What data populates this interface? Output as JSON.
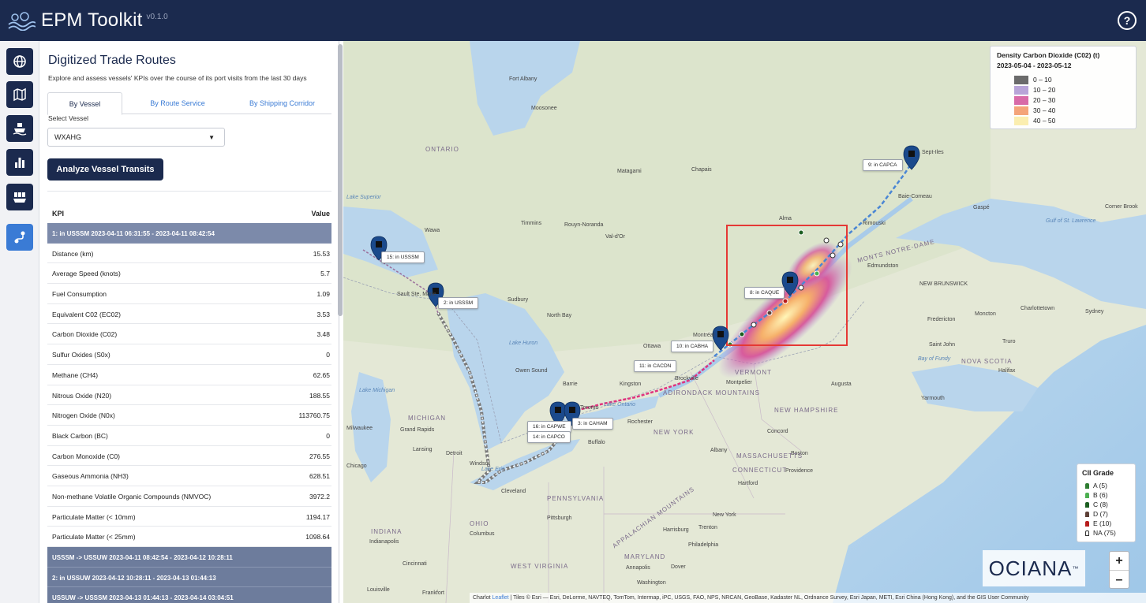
{
  "header": {
    "title": "EPM Toolkit",
    "version": "v0.1.0"
  },
  "rail": {
    "items": [
      {
        "icon": "globe-icon"
      },
      {
        "icon": "map-icon"
      },
      {
        "icon": "ship-icon"
      },
      {
        "icon": "bar-chart-icon"
      },
      {
        "icon": "port-icon"
      },
      {
        "icon": "route-icon",
        "active": true
      }
    ]
  },
  "panel": {
    "title": "Digitized Trade Routes",
    "subtitle": "Explore and assess vessels' KPIs over the course of its port visits from the last 30 days",
    "tabs": [
      "By Vessel",
      "By Route Service",
      "By Shipping Corridor"
    ],
    "vessel_label": "Select Vessel",
    "vessel_value": "WXAHG",
    "analyze_button": "Analyze Vessel Transits",
    "kpi_header": "KPI",
    "value_header": "Value",
    "active_segment": "1: in USSSM 2023-04-11 06:31:55 - 2023-04-11 08:42:54",
    "kpis": [
      {
        "name": "Distance (km)",
        "value": "15.53"
      },
      {
        "name": "Average Speed (knots)",
        "value": "5.7"
      },
      {
        "name": "Fuel Consumption",
        "value": "1.09"
      },
      {
        "name": "Equivalent C02 (EC02)",
        "value": "3.53"
      },
      {
        "name": "Carbon Dioxide (C02)",
        "value": "3.48"
      },
      {
        "name": "Sulfur Oxides (S0x)",
        "value": "0"
      },
      {
        "name": "Methane (CH4)",
        "value": "62.65"
      },
      {
        "name": "Nitrous Oxide (N20)",
        "value": "188.55"
      },
      {
        "name": "Nitrogen Oxide (N0x)",
        "value": "113760.75"
      },
      {
        "name": "Black Carbon (BC)",
        "value": "0"
      },
      {
        "name": "Carbon Monoxide (C0)",
        "value": "276.55"
      },
      {
        "name": "Gaseous Ammonia (NH3)",
        "value": "628.51"
      },
      {
        "name": "Non-methane Volatile Organic Compounds (NMVOC)",
        "value": "3972.2"
      },
      {
        "name": "Particulate Matter (< 10mm)",
        "value": "1194.17"
      },
      {
        "name": "Particulate Matter (< 25mm)",
        "value": "1098.64"
      }
    ],
    "segments": [
      "USSSM -> USSUW 2023-04-11 08:42:54 - 2023-04-12 10:28:11",
      "2: in USSUW 2023-04-12 10:28:11 - 2023-04-13 01:44:13",
      "USSUW -> USSSM 2023-04-13 01:44:13 - 2023-04-14 03:04:51"
    ]
  },
  "map": {
    "legend": {
      "title": "Density Carbon Dioxide (C02) (t)",
      "dates": "2023-05-04 - 2023-05-12",
      "bins": [
        {
          "label": "0 – 10",
          "color": "#6b6b6b"
        },
        {
          "label": "10 – 20",
          "color": "#b8a4d8"
        },
        {
          "label": "20 – 30",
          "color": "#d86aa8"
        },
        {
          "label": "30 – 40",
          "color": "#f4a47a"
        },
        {
          "label": "40 – 50",
          "color": "#fbeeb0"
        }
      ]
    },
    "cii": {
      "title": "CII Grade",
      "grades": [
        {
          "label": "A (5)",
          "color": "#2e7d32"
        },
        {
          "label": "B (6)",
          "color": "#4caf50"
        },
        {
          "label": "C (8)",
          "color": "#1b5e20"
        },
        {
          "label": "D (7)",
          "color": "#5d4037"
        },
        {
          "label": "E (10)",
          "color": "#b71c1c"
        },
        {
          "label": "NA (75)",
          "color": "#ffffff"
        }
      ]
    },
    "brand": "OCIANA",
    "zoom_in": "+",
    "zoom_out": "–",
    "attribution_prefix": "Charlot",
    "attribution_link": "Leaflet",
    "attribution_text": "| Tiles © Esri — Esri, DeLorme, NAVTEQ, TomTom, Intermap, iPC, USGS, FAO, NPS, NRCAN, GeoBase, Kadaster NL, Ordnance Survey, Esri Japan, METI, Esri China (Hong Kong), and the GIS User Community",
    "ports": [
      {
        "label": "9: in CAPCA"
      },
      {
        "label": "15: in USSSM"
      },
      {
        "label": "2: in USSSM"
      },
      {
        "label": "8: in CAQUE"
      },
      {
        "label": "10: in CABHA"
      },
      {
        "label": "11: in CACDN"
      },
      {
        "label": "16: in CAPWE"
      },
      {
        "label": "14: in CAPCO"
      },
      {
        "label": "3: in CAHAM"
      }
    ],
    "places": [
      "Fort Albany",
      "Moosonee",
      "ONTARIO",
      "Matagami",
      "Chapais",
      "Sept-Iles",
      "Baie-Comeau",
      "Gaspé",
      "Timmins",
      "Rouyn-Noranda",
      "Val-d'Or",
      "Alma",
      "Rimouski",
      "Wawa",
      "Sudbury",
      "North Bay",
      "Ottawa",
      "Montréal",
      "Edmundston",
      "NEW BRUNSWICK",
      "Fredericton",
      "Moncton",
      "Charlottetown",
      "Saint John",
      "Truro",
      "NOVA SCOTIA",
      "Halifax",
      "Owen Sound",
      "Barrie",
      "Kingston",
      "Brockville",
      "Toronto",
      "Rochester",
      "Buffalo",
      "MICHIGAN",
      "Grand Rapids",
      "Lansing",
      "Detroit",
      "Windsor",
      "Chicago",
      "Milwaukee",
      "Cleveland",
      "PENNSYLVANIA",
      "Pittsburgh",
      "OHIO",
      "Columbus",
      "INDIANA",
      "Indianapolis",
      "Cincinnati",
      "WEST VIRGINIA",
      "Louisville",
      "Frankfort",
      "NEW YORK",
      "Albany",
      "Boston",
      "Providence",
      "Hartford",
      "New York",
      "Trenton",
      "Harrisburg",
      "Philadelphia",
      "MARYLAND",
      "Annapolis",
      "Dover",
      "Washington",
      "VERMONT",
      "Montpelier",
      "Concord",
      "Augusta",
      "Yarmouth",
      "ADIRONDACK MOUNTAINS",
      "NEW HAMPSHIRE",
      "MASSACHUSETTS",
      "CONNECTICUT",
      "MONTS NOTRE-DAME",
      "APPALACHIAN MOUNTAINS",
      "Lake Huron",
      "Lake Michigan",
      "Bay of Fundy",
      "Gulf of St. Lawrence",
      "Sydney",
      "Corner Brook",
      "Sault Ste. Marie",
      "Lake Superior",
      "Lake Erie",
      "Lake Ontario"
    ]
  }
}
